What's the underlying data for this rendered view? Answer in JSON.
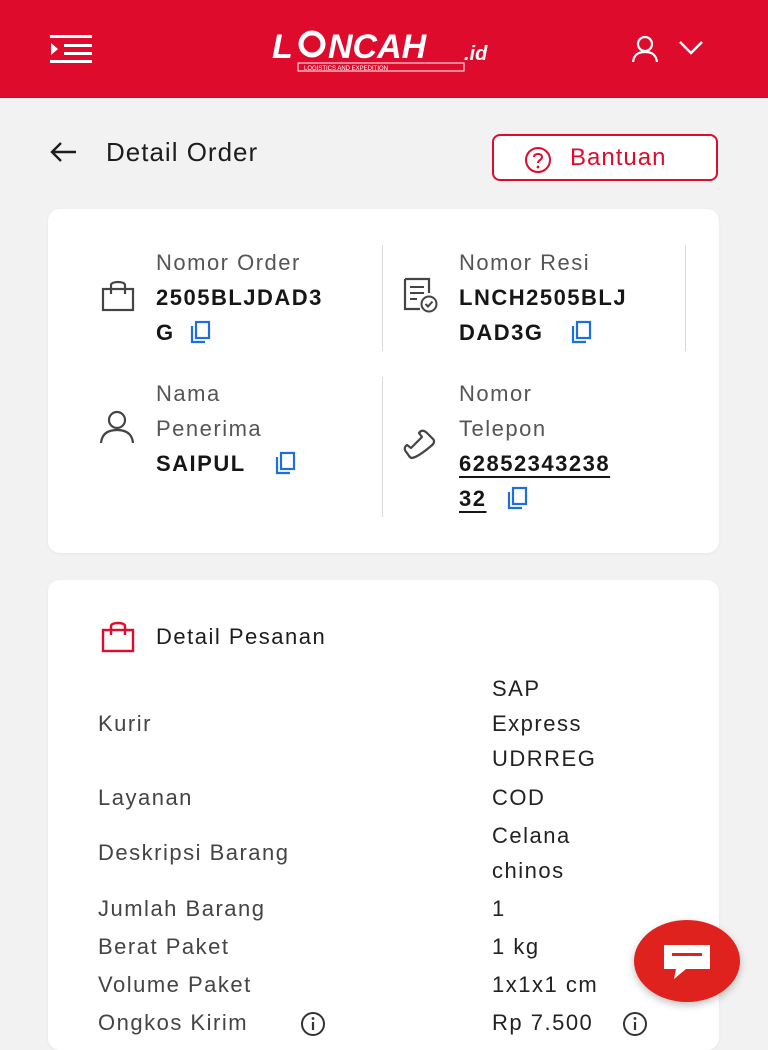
{
  "brand": {
    "logo_text": "LINCAH.id",
    "logo_tagline": "LOGISTICS AND EXPEDITION",
    "primary_color": "#de0b2c"
  },
  "header": {
    "menu_icon": "menu-icon",
    "user_icon": "user-icon",
    "dropdown_icon": "chevron-down-icon"
  },
  "page": {
    "title": "Detail Order",
    "back_icon": "arrow-left-icon",
    "help_label": "Bantuan",
    "help_icon": "question-circle-icon"
  },
  "order_info": {
    "order_number_label": "Nomor Order",
    "order_number_line1": "2505BLJDAD3",
    "order_number_line2": "G",
    "resi_label": "Nomor Resi",
    "resi_line1": "LNCH2505BLJ",
    "resi_line2": "DAD3G",
    "recipient_label_line1": "Nama",
    "recipient_label_line2": "Penerima",
    "recipient_name": "SAIPUL",
    "phone_label_line1": "Nomor",
    "phone_label_line2": "Telepon",
    "phone_line1": "62852343238",
    "phone_line2": "32"
  },
  "order_detail": {
    "section_title": "Detail Pesanan",
    "rows": [
      {
        "label": "Kurir",
        "value_lines": [
          "SAP",
          "Express",
          "UDRREG"
        ]
      },
      {
        "label": "Layanan",
        "value_lines": [
          "COD"
        ]
      },
      {
        "label": "Deskripsi Barang",
        "value_lines": [
          "Celana",
          "chinos"
        ]
      },
      {
        "label": "Jumlah Barang",
        "value_lines": [
          "1"
        ]
      },
      {
        "label": "Berat Paket",
        "value_lines": [
          "1 kg"
        ]
      },
      {
        "label": "Volume Paket",
        "value_lines": [
          "1x1x1 cm"
        ]
      },
      {
        "label": "Ongkos Kirim",
        "value_lines": [
          "Rp 7.500"
        ]
      }
    ]
  },
  "chat": {
    "icon": "chat-bubble-icon"
  }
}
